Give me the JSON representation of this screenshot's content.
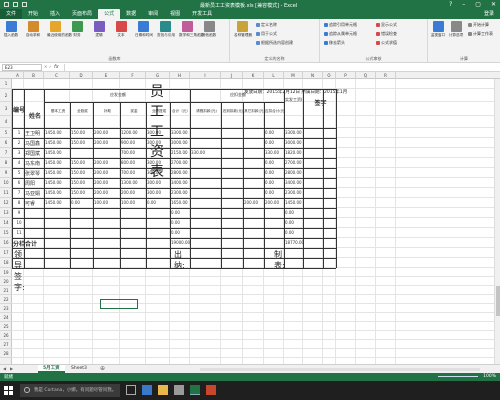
{
  "window": {
    "title": "最新员工工资表模板.xls [兼容模式] - Excel"
  },
  "tabs": [
    "文件",
    "开始",
    "插入",
    "页面布局",
    "公式",
    "数据",
    "审阅",
    "视图",
    "开发工具"
  ],
  "active_tab": "公式",
  "login": "登录",
  "ribbon": {
    "groups": [
      {
        "label": "函数库",
        "buttons": [
          "插入函数",
          "自动求和",
          "最近使用的函数",
          "财务",
          "逻辑",
          "文本",
          "日期和时间",
          "查找与引用",
          "数学和三角函数",
          "其他函数"
        ]
      },
      {
        "label": "定义的名称",
        "buttons": [
          "名称管理器"
        ],
        "small": [
          "定义名称",
          "用于公式",
          "根据所选内容创建"
        ]
      },
      {
        "label": "公式审核",
        "small": [
          "追踪引用单元格",
          "追踪从属单元格",
          "移去箭头",
          "显示公式",
          "错误检查",
          "公式求值"
        ]
      },
      {
        "label": "计算",
        "buttons": [
          "监视窗口",
          "计算选项"
        ],
        "small": [
          "开始计算",
          "计算工作表"
        ]
      }
    ]
  },
  "formula_bar": {
    "name_box": "E23",
    "fx": "fx",
    "value": ""
  },
  "columns": [
    "A",
    "B",
    "C",
    "D",
    "E",
    "F",
    "G",
    "H",
    "I",
    "J",
    "K",
    "L",
    "M",
    "N",
    "O",
    "P",
    "Q",
    "R"
  ],
  "rows": [
    "1",
    "2",
    "3",
    "4",
    "5",
    "6",
    "7",
    "8",
    "9",
    "10",
    "11",
    "12",
    "13",
    "14",
    "15",
    "16",
    "17",
    "18",
    "19",
    "20",
    "21",
    "22",
    "23",
    "24",
    "25",
    "26",
    "27",
    "28"
  ],
  "sheet": {
    "title": "员工工资表",
    "meta": "发放日期：2015年2月12日  所属日期：2015年1月",
    "h_num": "编号",
    "h_name": "姓名",
    "h_payable": "应发金额",
    "h_deduct": "应扣金额",
    "h_actual": "实发工资(元)",
    "h_sign": "签字",
    "sub": [
      "基本工资",
      "全勤奖",
      "补助",
      "奖金",
      "业绩提成",
      "合计（元）",
      "请假扣款(元)",
      "迟到扣款(元)",
      "其它扣款(元)",
      "应扣合计(元)"
    ],
    "employees": [
      {
        "no": "1",
        "name": "王卫明",
        "base": "1450.00",
        "full": "150.00",
        "allow": "200.00",
        "bonus": "1200.00",
        "perf": "300.00",
        "total": "3300.00",
        "leave": "",
        "late": "",
        "other": "",
        "ded": "0.00",
        "actual": "3300.00"
      },
      {
        "no": "2",
        "name": "马国鑫",
        "base": "1450.00",
        "full": "150.00",
        "allow": "200.00",
        "bonus": "900.00",
        "perf": "300.00",
        "total": "3000.00",
        "leave": "",
        "late": "",
        "other": "",
        "ded": "0.00",
        "actual": "3000.00"
      },
      {
        "no": "3",
        "name": "郑国斌",
        "base": "1450.00",
        "full": "",
        "allow": "",
        "bonus": "700.00",
        "perf": "",
        "total": "2150.00",
        "leave": "330.00",
        "late": "",
        "other": "",
        "ded": "330.00",
        "actual": "1820.00"
      },
      {
        "no": "4",
        "name": "马东南",
        "base": "1450.00",
        "full": "150.00",
        "allow": "200.00",
        "bonus": "800.00",
        "perf": "300.00",
        "total": "2700.00",
        "leave": "",
        "late": "",
        "other": "",
        "ded": "0.00",
        "actual": "2700.00"
      },
      {
        "no": "5",
        "name": "张翠琴",
        "base": "1450.00",
        "full": "150.00",
        "allow": "200.00",
        "bonus": "700.00",
        "perf": "300.00",
        "total": "2800.00",
        "leave": "",
        "late": "",
        "other": "",
        "ded": "0.00",
        "actual": "2800.00"
      },
      {
        "no": "6",
        "name": "周阳",
        "base": "1450.00",
        "full": "150.00",
        "allow": "200.00",
        "bonus": "1300.00",
        "perf": "300.00",
        "total": "3400.00",
        "leave": "",
        "late": "",
        "other": "",
        "ded": "0.00",
        "actual": "3400.00"
      },
      {
        "no": "7",
        "name": "马亚娟",
        "base": "1450.00",
        "full": "150.00",
        "allow": "200.00",
        "bonus": "200.00",
        "perf": "300.00",
        "total": "2300.00",
        "leave": "",
        "late": "",
        "other": "",
        "ded": "0.00",
        "actual": "2300.00"
      },
      {
        "no": "8",
        "name": "可睿",
        "base": "1450.00",
        "full": "0.00",
        "allow": "100.00",
        "bonus": "100.00",
        "perf": "0.00",
        "total": "1650.00",
        "leave": "",
        "late": "",
        "other": "200.00",
        "ded": "200.00",
        "actual": "1450.00"
      },
      {
        "no": "9",
        "name": "",
        "base": "",
        "full": "",
        "allow": "",
        "bonus": "",
        "perf": "",
        "total": "0.00",
        "leave": "",
        "late": "",
        "other": "",
        "ded": "",
        "actual": "0.00"
      },
      {
        "no": "10",
        "name": "",
        "base": "",
        "full": "",
        "allow": "",
        "bonus": "",
        "perf": "",
        "total": "0.00",
        "leave": "",
        "late": "",
        "other": "",
        "ded": "",
        "actual": "0.00"
      },
      {
        "no": "11",
        "name": "",
        "base": "",
        "full": "",
        "allow": "",
        "bonus": "",
        "perf": "",
        "total": "0.00",
        "leave": "",
        "late": "",
        "other": "",
        "ded": "",
        "actual": "0.00"
      }
    ],
    "subtotal_label": "分栏合计",
    "subtotal_total": "19000.00",
    "subtotal_actual": "18770.00",
    "sign_leader": "领导签字:",
    "sign_cashier": "出纳:",
    "sign_maker": "制表:"
  },
  "sheet_tabs": [
    "5月工资",
    "Sheet3"
  ],
  "active_sheet": "5月工资",
  "status": {
    "ready": "就绪",
    "zoom": "100%"
  },
  "taskbar": {
    "search_placeholder": "我是 Cortana，小娜。有问题尽管问我。"
  },
  "colors": {
    "excel_green": "#217346"
  }
}
